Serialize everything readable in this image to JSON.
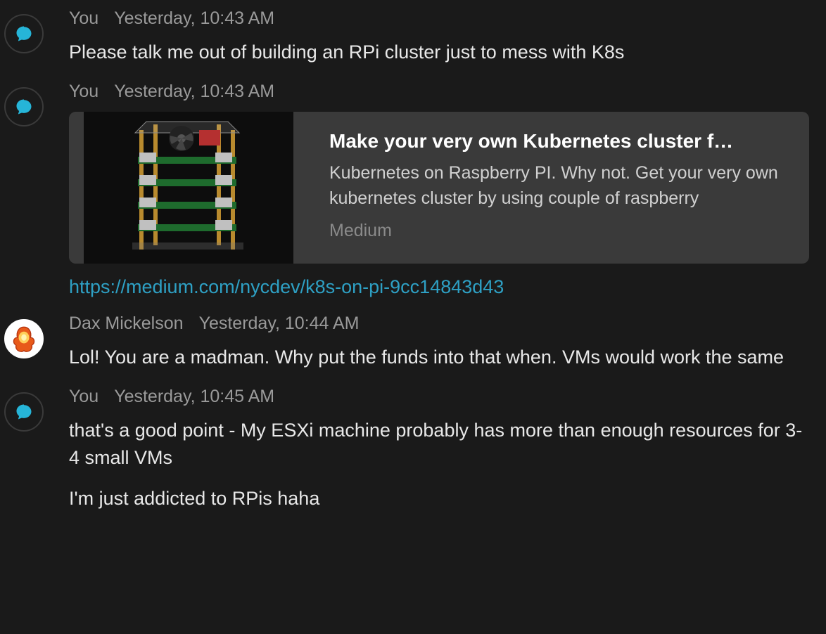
{
  "messages": [
    {
      "author": "You",
      "time": "Yesterday, 10:43 AM",
      "avatar": "self",
      "lines": [
        "Please talk me out of building an RPi cluster just to mess with K8s"
      ]
    },
    {
      "author": "You",
      "time": "Yesterday, 10:43 AM",
      "avatar": "self",
      "card": {
        "title": "Make your very own Kubernetes cluster f…",
        "desc": "Kubernetes on Raspberry PI. Why not. Get your very own kubernetes cluster by using couple of raspberry",
        "source": "Medium"
      },
      "link": "https://medium.com/nycdev/k8s-on-pi-9cc14843d43"
    },
    {
      "author": "Dax Mickelson",
      "time": "Yesterday, 10:44 AM",
      "avatar": "dax",
      "lines": [
        "Lol!  You are a madman.  Why put the funds into that when. VMs would work the same"
      ]
    },
    {
      "author": "You",
      "time": "Yesterday, 10:45 AM",
      "avatar": "self",
      "lines": [
        "that's a good point - My ESXi machine probably has more than enough resources for 3-4 small VMs",
        "I'm just addicted to RPis haha"
      ]
    }
  ]
}
